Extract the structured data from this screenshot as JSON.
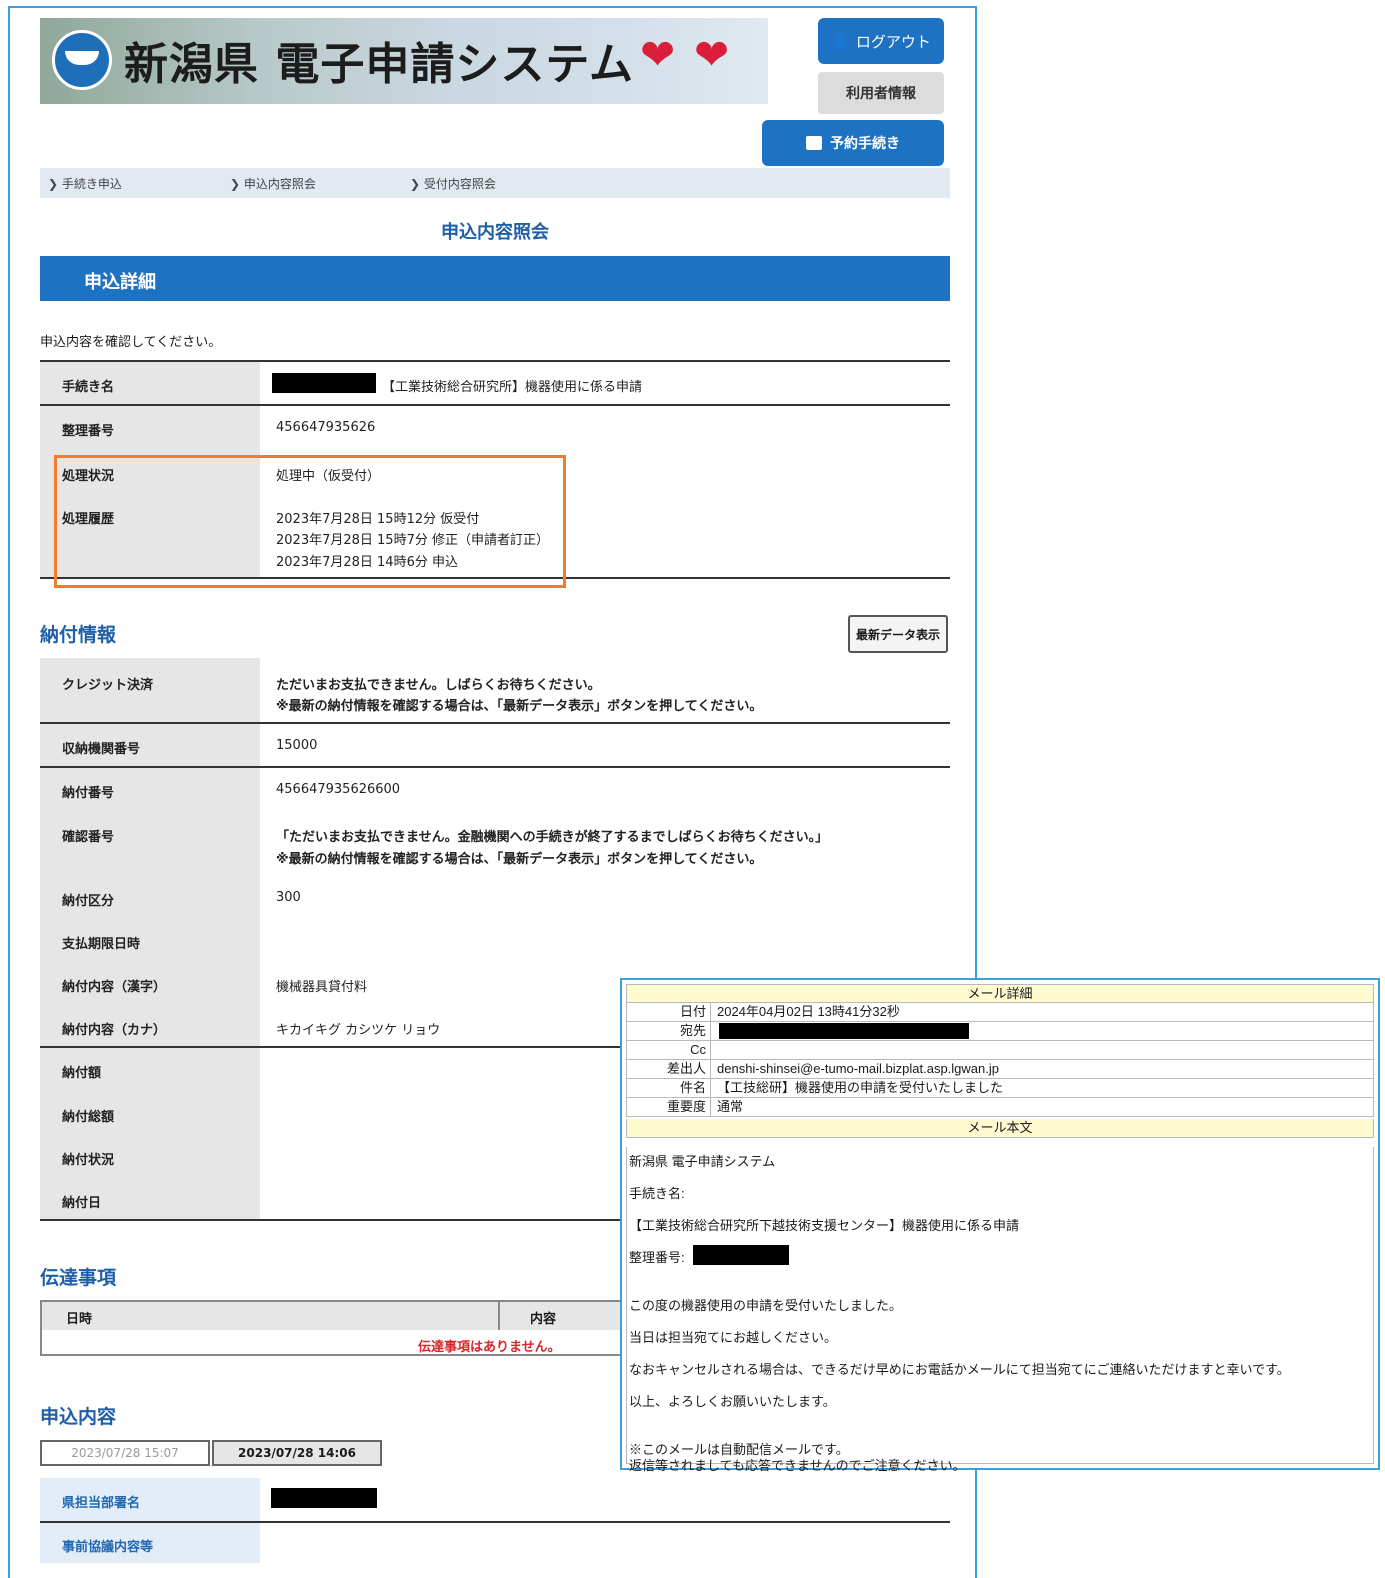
{
  "header": {
    "system_title": "新潟県 電子申請システム",
    "logout_label": "ログアウト",
    "user_info_label": "利用者情報",
    "reserve_label": "予約手続き"
  },
  "steps": [
    "手続き申込",
    "申込内容照会",
    "受付内容照会"
  ],
  "page_title": "申込内容照会",
  "section_title": "申込詳細",
  "instruction": "申込内容を確認してください。",
  "details": {
    "proc_name_label": "手続き名",
    "proc_name_value": "【工業技術総合研究所】機器使用に係る申請",
    "ref_no_label": "整理番号",
    "ref_no_value": "456647935626",
    "status_label": "処理状況",
    "status_value": "処理中（仮受付）",
    "history_label": "処理履歴",
    "history": [
      "2023年7月28日 15時12分 仮受付",
      "2023年7月28日 15時7分 修正（申請者訂正）",
      "2023年7月28日 14時6分 申込"
    ]
  },
  "payment": {
    "heading": "納付情報",
    "latest_button": "最新データ表示",
    "credit_label": "クレジット決済",
    "credit_msg_red": "ただいまお支払できません。しばらくお待ちください。",
    "credit_msg_blue": "※最新の納付情報を確認する場合は、「最新データ表示」ボタンを押してください。",
    "agency_no_label": "収納機関番号",
    "agency_no_value": "15000",
    "payment_no_label": "納付番号",
    "payment_no_value": "456647935626600",
    "confirm_no_label": "確認番号",
    "confirm_msg_red": "「ただいまお支払できません。金融機関への手続きが終了するまでしばらくお待ちください。」",
    "confirm_msg_blue": "※最新の納付情報を確認する場合は、「最新データ表示」ボタンを押してください。",
    "category_label": "納付区分",
    "category_value": "300",
    "deadline_label": "支払期限日時",
    "content_kanji_label": "納付内容（漢字）",
    "content_kanji_value": "機械器具貸付料",
    "content_kana_label": "納付内容（カナ）",
    "content_kana_value": "キカイキグ カシツケ リョウ",
    "amount_label": "納付額",
    "amount_total_label": "納付総額",
    "state_label": "納付状況",
    "date_label": "納付日"
  },
  "notices": {
    "heading": "伝達事項",
    "col_date": "日時",
    "col_content": "内容",
    "empty": "伝達事項はありません。"
  },
  "application": {
    "heading": "申込内容",
    "tab_old": "2023/07/28 15:07",
    "tab_current": "2023/07/28 14:06",
    "dept_label": "県担当部署名",
    "contact_label": "事前協議内容等"
  },
  "mail": {
    "detail_header": "メール詳細",
    "date_label": "日付",
    "date_value": "2024年04月02日 13時41分32秒",
    "to_label": "宛先",
    "cc_label": "Cc",
    "from_label": "差出人",
    "from_value": "denshi-shinsei@e-tumo-mail.bizplat.asp.lgwan.jp",
    "subject_label": "件名",
    "subject_value": "【工技総研】機器使用の申請を受付いたしました",
    "priority_label": "重要度",
    "priority_value": "通常",
    "body_header": "メール本文",
    "body": {
      "l1": "新潟県 電子申請システム",
      "l2": "手続き名:",
      "l3": "【工業技術総合研究所下越技術支援センター】機器使用に係る申請",
      "l4": "整理番号:",
      "l5": "この度の機器使用の申請を受付いたしました。",
      "l6": "当日は担当宛てにお越しください。",
      "l7": "なおキャンセルされる場合は、できるだけ早めにお電話かメールにて担当宛てにご連絡いただけますと幸いです。",
      "l8": "以上、よろしくお願いいたします。",
      "l9": "※このメールは自動配信メールです。",
      "l10": "返信等されましても応答できませんのでご注意ください。"
    }
  }
}
